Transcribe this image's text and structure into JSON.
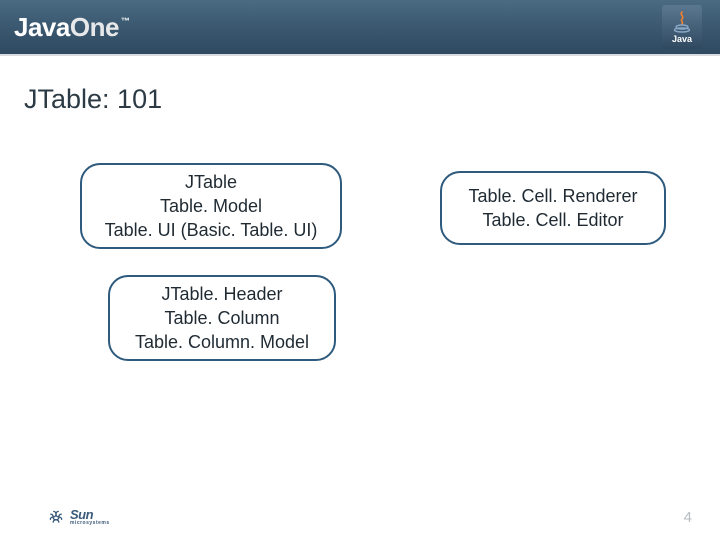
{
  "header": {
    "logo_main": "Java",
    "logo_one": "One",
    "logo_tm": "™",
    "java_label": "Java"
  },
  "slide": {
    "title": "JTable: 101"
  },
  "boxes": {
    "box1": {
      "line1": "JTable",
      "line2": "Table. Model",
      "line3": "Table. UI (Basic. Table. UI)"
    },
    "box2": {
      "line1": "Table. Cell. Renderer",
      "line2": "Table. Cell. Editor"
    },
    "box3": {
      "line1": "JTable. Header",
      "line2": "Table. Column",
      "line3": "Table. Column. Model"
    }
  },
  "footer": {
    "sun_top": "Sun",
    "sun_bot": "microsystems",
    "page": "4"
  }
}
